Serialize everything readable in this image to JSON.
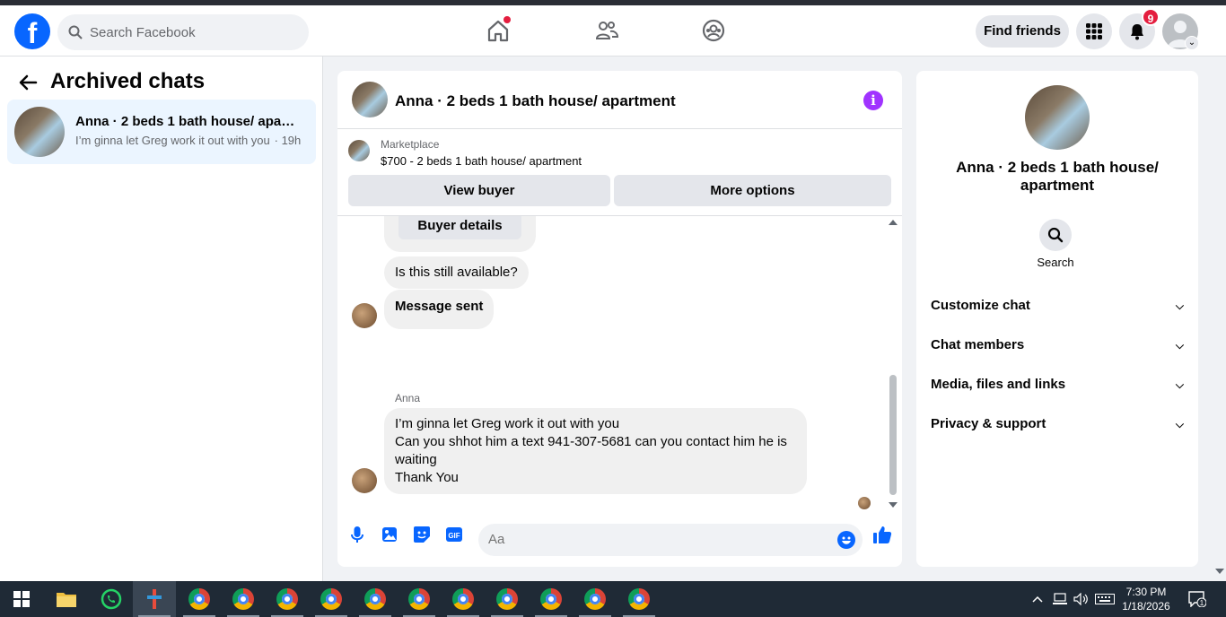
{
  "topbar": {
    "logo_letter": "f",
    "search_placeholder": "Search Facebook",
    "find_friends": "Find friends",
    "notification_count": "9"
  },
  "sidebar": {
    "title": "Archived chats",
    "chats": [
      {
        "title": "Anna · 2 beds 1 bath house/ apartment",
        "preview": "I’m ginna let Greg work it out with you",
        "time": "· 19h"
      }
    ]
  },
  "chat": {
    "title": "Anna · 2 beds 1 bath house/ apartment",
    "marketplace_label": "Marketplace",
    "listing": "$700 - 2 beds 1 bath house/ apartment",
    "view_buyer": "View buyer",
    "more_options": "More options",
    "buyer_details": "Buyer details",
    "messages": [
      {
        "text": "Is this still available?"
      },
      {
        "text": "Message sent"
      }
    ],
    "sender_name": "Anna",
    "last_message_lines": [
      "I’m ginna let Greg work it out with you",
      "Can you shhot him a text 941-307-5681 can you contact him he is waiting",
      "Thank You"
    ],
    "composer_placeholder": "Aa"
  },
  "info_panel": {
    "title": "Anna · 2 beds 1 bath house/ apartment",
    "search_label": "Search",
    "sections": [
      "Customize chat",
      "Chat members",
      "Media, files and links",
      "Privacy & support"
    ]
  },
  "taskbar": {
    "time": "7:30 PM",
    "date": "1/18/2026",
    "notif_count": "1"
  },
  "colors": {
    "accent": "#0866ff",
    "info": "#a033ff",
    "badge": "#e41e3f"
  }
}
